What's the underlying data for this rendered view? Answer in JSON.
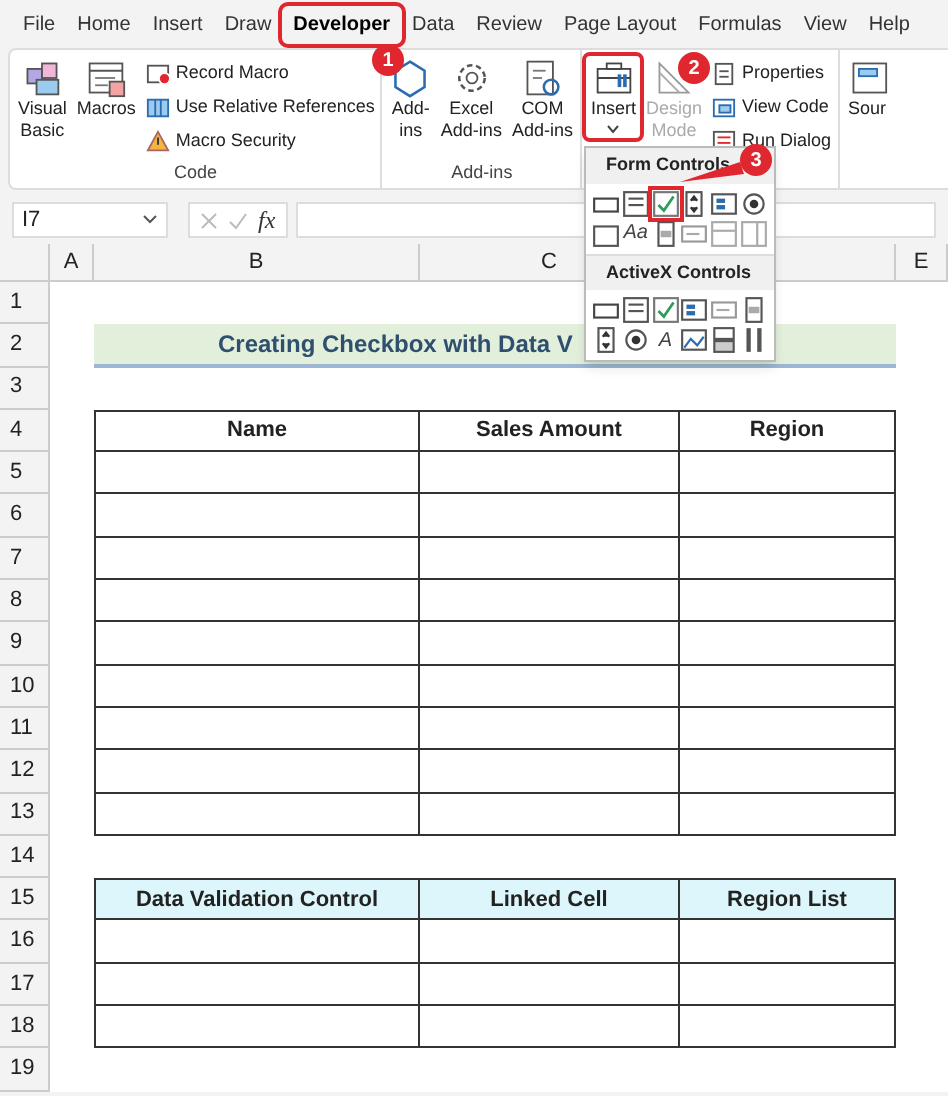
{
  "ribbon_tabs": [
    {
      "label": "File",
      "selected": false,
      "highlighted": false
    },
    {
      "label": "Home",
      "selected": false,
      "highlighted": false
    },
    {
      "label": "Insert",
      "selected": false,
      "highlighted": false
    },
    {
      "label": "Draw",
      "selected": false,
      "highlighted": false
    },
    {
      "label": "Developer",
      "selected": true,
      "highlighted": true,
      "callout": "1"
    },
    {
      "label": "Data",
      "selected": false,
      "highlighted": false
    },
    {
      "label": "Review",
      "selected": false,
      "highlighted": false
    },
    {
      "label": "Page Layout",
      "selected": false,
      "highlighted": false
    },
    {
      "label": "Formulas",
      "selected": false,
      "highlighted": false
    },
    {
      "label": "View",
      "selected": false,
      "highlighted": false
    },
    {
      "label": "Help",
      "selected": false,
      "highlighted": false
    }
  ],
  "ribbon_groups": [
    {
      "label": "Code",
      "large": [
        {
          "label": "Visual\nBasic",
          "disabled": false
        },
        {
          "label": "Macros",
          "disabled": false
        }
      ],
      "small": [
        "Record Macro",
        "Use Relative References",
        "Macro Security"
      ]
    },
    {
      "label": "Add-ins",
      "large": [
        {
          "label": "Add-\nins",
          "disabled": false
        },
        {
          "label": "Excel\nAdd-ins",
          "disabled": false
        },
        {
          "label": "COM\nAdd-ins",
          "disabled": false
        }
      ]
    },
    {
      "large": [
        {
          "label": "Insert",
          "dropdown": true,
          "highlighted": true,
          "callout": "2",
          "disabled": false
        },
        {
          "label": "Design\nMode",
          "disabled": true
        }
      ],
      "small": [
        "Properties",
        "View Code",
        "Run Dialog"
      ]
    },
    {
      "large": [
        {
          "label": "Sour",
          "disabled": false
        }
      ]
    }
  ],
  "formula_bar": {
    "name_box": "I7",
    "function_symbol": "fx"
  },
  "insert_menu": {
    "sections": [
      {
        "title": "Form Controls",
        "items": [
          {
            "kind": "button"
          },
          {
            "kind": "combo"
          },
          {
            "kind": "checkbox",
            "highlighted": true,
            "callout": "3"
          },
          {
            "kind": "spin"
          },
          {
            "kind": "listbox"
          },
          {
            "kind": "option"
          },
          {
            "kind": "group"
          },
          {
            "kind": "glyph",
            "text": "Aa"
          },
          {
            "kind": "scroll"
          },
          {
            "kind": "textfield"
          },
          {
            "kind": "combolist"
          },
          {
            "kind": "combodrop"
          }
        ]
      },
      {
        "title": "ActiveX Controls",
        "items": [
          {
            "kind": "button"
          },
          {
            "kind": "combo"
          },
          {
            "kind": "checkbox"
          },
          {
            "kind": "listbox"
          },
          {
            "kind": "textfield"
          },
          {
            "kind": "scroll"
          },
          {
            "kind": "spin"
          },
          {
            "kind": "option"
          },
          {
            "kind": "glyph",
            "text": "A"
          },
          {
            "kind": "image"
          },
          {
            "kind": "toggle"
          },
          {
            "kind": "more"
          }
        ]
      }
    ]
  },
  "sheet": {
    "columns": [
      "A",
      "B",
      "C",
      "E"
    ],
    "rows": [
      {
        "number": "1",
        "kind": "blank"
      },
      {
        "number": "2",
        "kind": "title",
        "text": "Creating Checkbox with Data V"
      },
      {
        "number": "3",
        "kind": "blank"
      },
      {
        "number": "4",
        "kind": "header",
        "tinted": false,
        "cells": [
          "Name",
          "Sales Amount",
          "Region"
        ]
      },
      {
        "number": "5",
        "kind": "body"
      },
      {
        "number": "6",
        "kind": "body"
      },
      {
        "number": "7",
        "kind": "body"
      },
      {
        "number": "8",
        "kind": "body"
      },
      {
        "number": "9",
        "kind": "body"
      },
      {
        "number": "10",
        "kind": "body"
      },
      {
        "number": "11",
        "kind": "body"
      },
      {
        "number": "12",
        "kind": "body"
      },
      {
        "number": "13",
        "kind": "body"
      },
      {
        "number": "14",
        "kind": "blank"
      },
      {
        "number": "15",
        "kind": "header",
        "tinted": true,
        "cells": [
          "Data Validation Control",
          "Linked Cell",
          "Region List"
        ]
      },
      {
        "number": "16",
        "kind": "body"
      },
      {
        "number": "17",
        "kind": "body"
      },
      {
        "number": "18",
        "kind": "body"
      },
      {
        "number": "19",
        "kind": "blank"
      }
    ]
  }
}
